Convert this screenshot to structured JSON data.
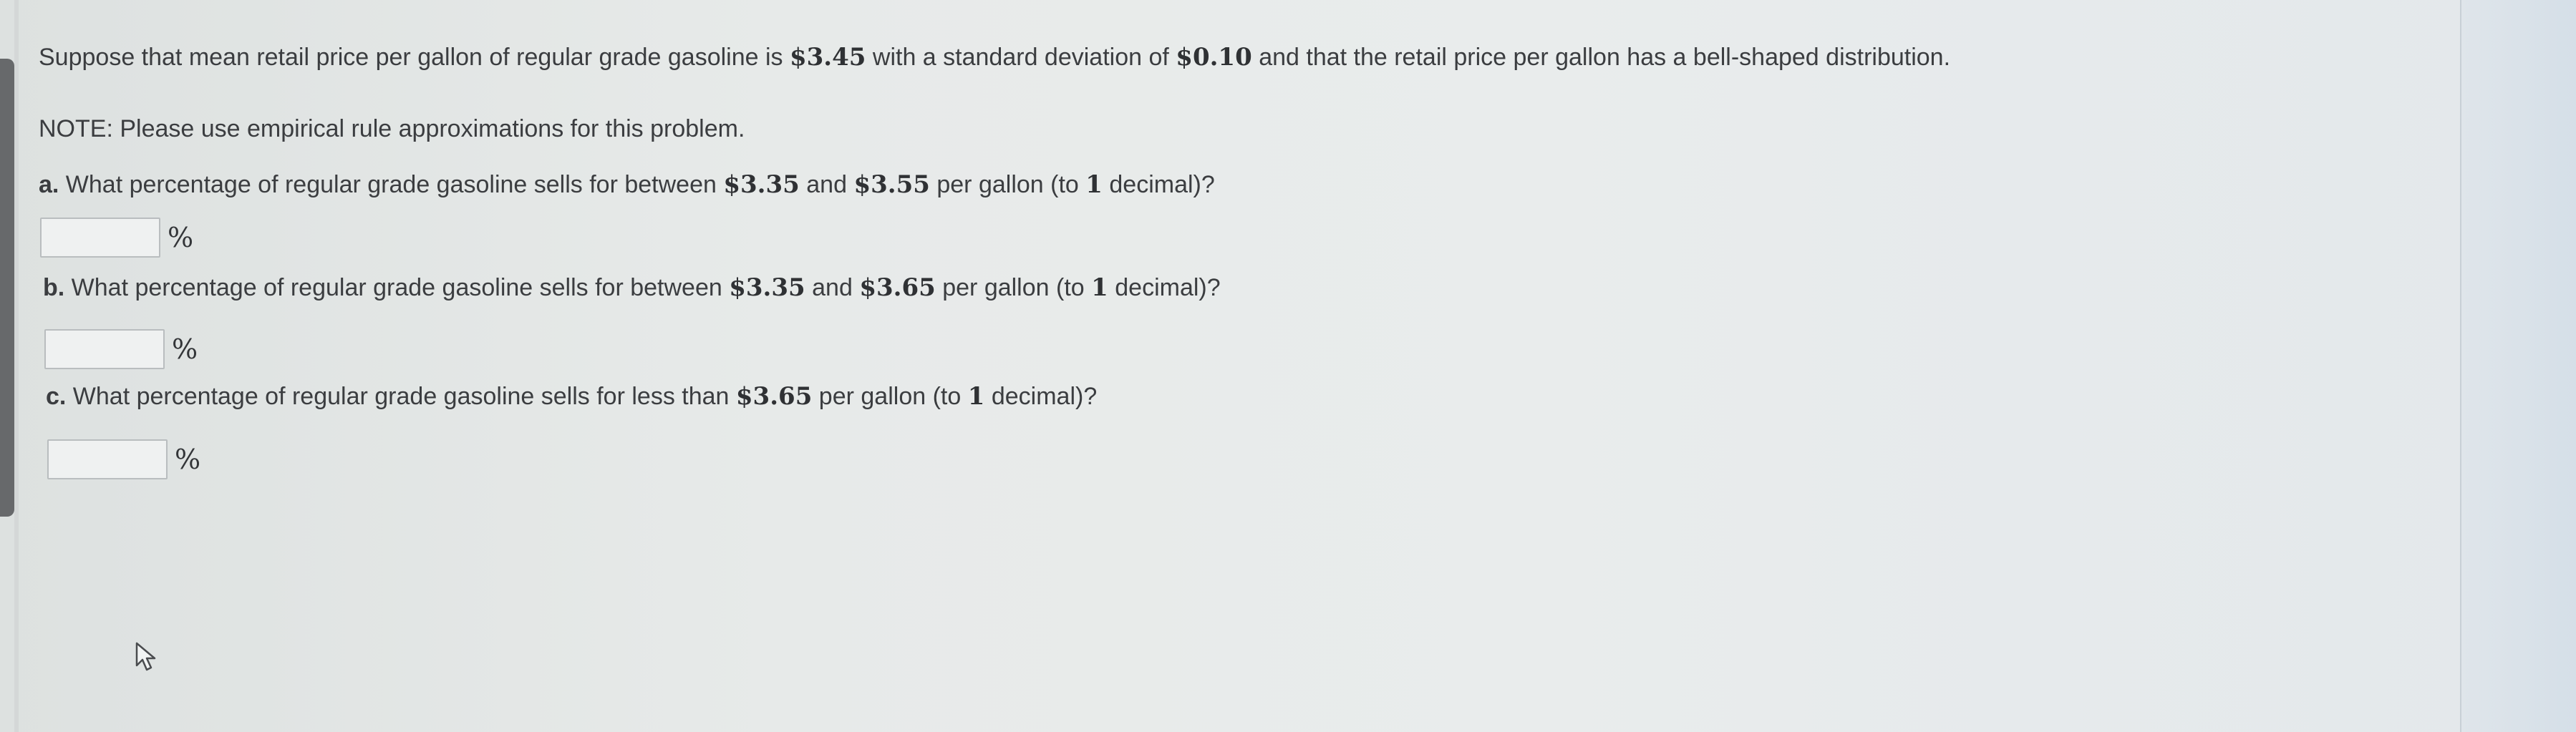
{
  "intro": {
    "pre": "Suppose that mean retail price per gallon of regular grade gasoline is ",
    "mean": "$3.45",
    "mid": " with a standard deviation of ",
    "sd": "$0.10",
    "post": " and that the retail price per gallon has a bell-shaped distribution."
  },
  "note": "NOTE: Please use empirical rule approximations for this problem.",
  "questions": [
    {
      "letter": "a.",
      "pre": " What percentage of regular grade gasoline sells for between ",
      "v1": "$3.35",
      "mid": " and ",
      "v2": "$3.55",
      "post": " per gallon (to ",
      "decimals": "1",
      "end": " decimal)?",
      "answer_value": "",
      "unit": "%"
    },
    {
      "letter": "b.",
      "pre": " What percentage of regular grade gasoline sells for between ",
      "v1": "$3.35",
      "mid": " and ",
      "v2": "$3.65",
      "post": " per gallon (to ",
      "decimals": "1",
      "end": " decimal)?",
      "answer_value": "",
      "unit": "%"
    },
    {
      "letter": "c.",
      "pre": " What percentage of regular grade gasoline sells for less than ",
      "v1": "$3.65",
      "post": " per gallon (to ",
      "decimals": "1",
      "end": " decimal)?",
      "answer_value": "",
      "unit": "%"
    }
  ]
}
